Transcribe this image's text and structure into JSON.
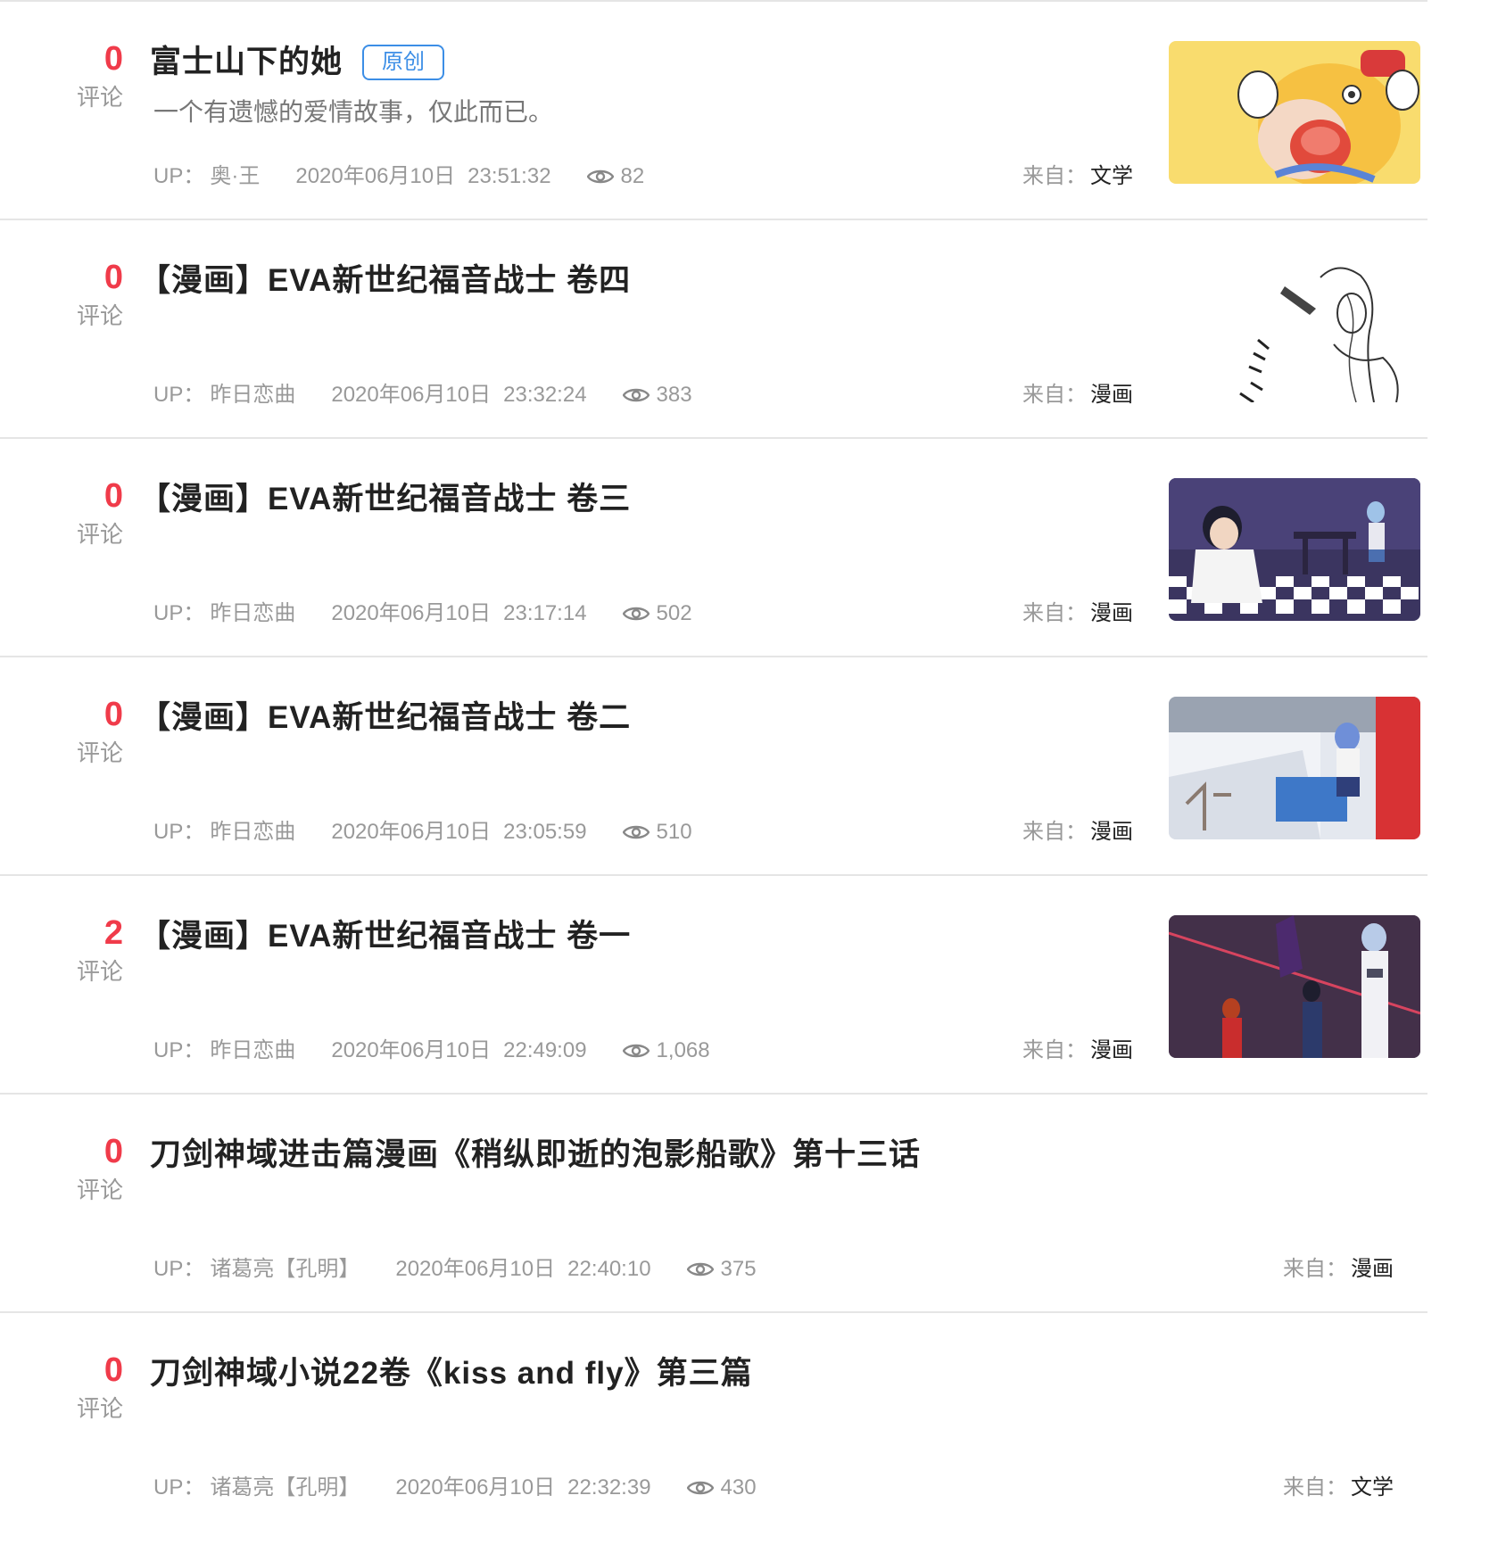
{
  "comment_label": "评论",
  "up_label": "UP：",
  "from_label": "来自：",
  "original_badge": "原创",
  "colors": {
    "accent_red": "#f03b4a",
    "badge_blue": "#3c8ee6",
    "muted_text": "#999999",
    "divider": "#e5e5e5"
  },
  "articles": [
    {
      "comments": "0",
      "title": "富士山下的她",
      "original": true,
      "description": "一个有遗憾的爱情故事，仅此而已。",
      "uploader": "奥·王",
      "date": "2020年06月10日",
      "time": "23:51:32",
      "views": "82",
      "source": "文学",
      "thumbnail": "cartoon-girl-yellow"
    },
    {
      "comments": "0",
      "title": "【漫画】EVA新世纪福音战士  卷四",
      "original": false,
      "description": "",
      "uploader": "昨日恋曲",
      "date": "2020年06月10日",
      "time": "23:32:24",
      "views": "383",
      "source": "漫画",
      "thumbnail": "manga-sketch-bw"
    },
    {
      "comments": "0",
      "title": "【漫画】EVA新世纪福音战士  卷三",
      "original": false,
      "description": "",
      "uploader": "昨日恋曲",
      "date": "2020年06月10日",
      "time": "23:17:14",
      "views": "502",
      "source": "漫画",
      "thumbnail": "eva-classroom-checkered"
    },
    {
      "comments": "0",
      "title": "【漫画】EVA新世纪福音战士  卷二",
      "original": false,
      "description": "",
      "uploader": "昨日恋曲",
      "date": "2020年06月10日",
      "time": "23:05:59",
      "views": "510",
      "source": "漫画",
      "thumbnail": "eva-rooftop-red"
    },
    {
      "comments": "2",
      "title": "【漫画】EVA新世纪福音战士  卷一",
      "original": false,
      "description": "",
      "uploader": "昨日恋曲",
      "date": "2020年06月10日",
      "time": "22:49:09",
      "views": "1,068",
      "source": "漫画",
      "thumbnail": "eva-pilots-dark"
    },
    {
      "comments": "0",
      "title": "刀剑神域进击篇漫画《稍纵即逝的泡影船歌》第十三话",
      "original": false,
      "description": "",
      "uploader": "诸葛亮【孔明】",
      "date": "2020年06月10日",
      "time": "22:40:10",
      "views": "375",
      "source": "漫画",
      "thumbnail": ""
    },
    {
      "comments": "0",
      "title": "刀剑神域小说22卷《kiss  and  fly》第三篇",
      "original": false,
      "description": "",
      "uploader": "诸葛亮【孔明】",
      "date": "2020年06月10日",
      "time": "22:32:39",
      "views": "430",
      "source": "文学",
      "thumbnail": ""
    }
  ]
}
